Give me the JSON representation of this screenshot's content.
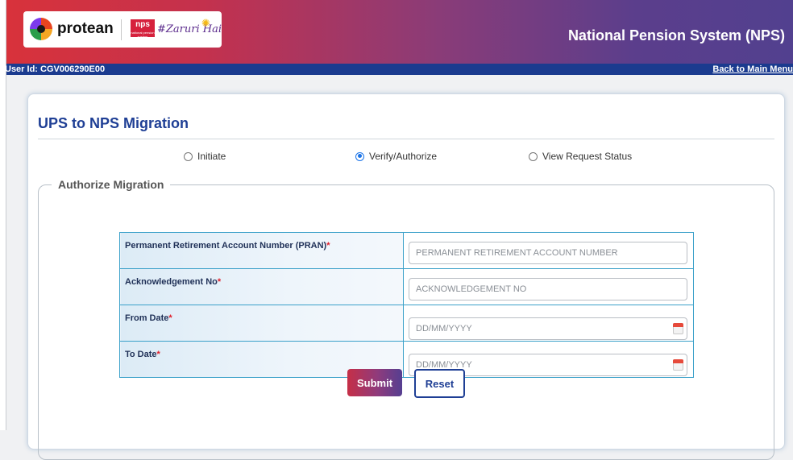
{
  "header": {
    "brand": "protean",
    "nps_badge": "nps",
    "nps_badge_sub": "national pension system",
    "tagline": "#Zaruri Hai",
    "title": "National Pension System (NPS)",
    "gradient_colors": [
      "#d8323b",
      "#8a3c78",
      "#52408f"
    ]
  },
  "user_bar": {
    "user_id": "User Id: CGV006290E00",
    "back_link": "Back to Main Menu",
    "color": "#1b3b8f"
  },
  "page": {
    "title": "UPS to NPS Migration"
  },
  "radio_options": [
    {
      "label": "Initiate",
      "selected": false
    },
    {
      "label": "Verify/Authorize",
      "selected": true
    },
    {
      "label": "View Request Status",
      "selected": false
    }
  ],
  "form": {
    "legend": "Authorize Migration",
    "fields": [
      {
        "label": "Permanent Retirement Account Number (PRAN)",
        "required": "*",
        "placeholder": "PERMANENT RETIREMENT ACCOUNT NUMBER",
        "value": ""
      },
      {
        "label": "Acknowledgement No",
        "required": "*",
        "placeholder": "ACKNOWLEDGEMENT NO",
        "value": ""
      },
      {
        "label": "From Date",
        "required": "*",
        "placeholder": "DD/MM/YYYY",
        "value": "",
        "icon": "calendar-icon"
      },
      {
        "label": "To Date",
        "required": "*",
        "placeholder": "DD/MM/YYYY",
        "value": "",
        "icon": "calendar-icon"
      }
    ],
    "submit_label": "Submit",
    "reset_label": "Reset"
  }
}
